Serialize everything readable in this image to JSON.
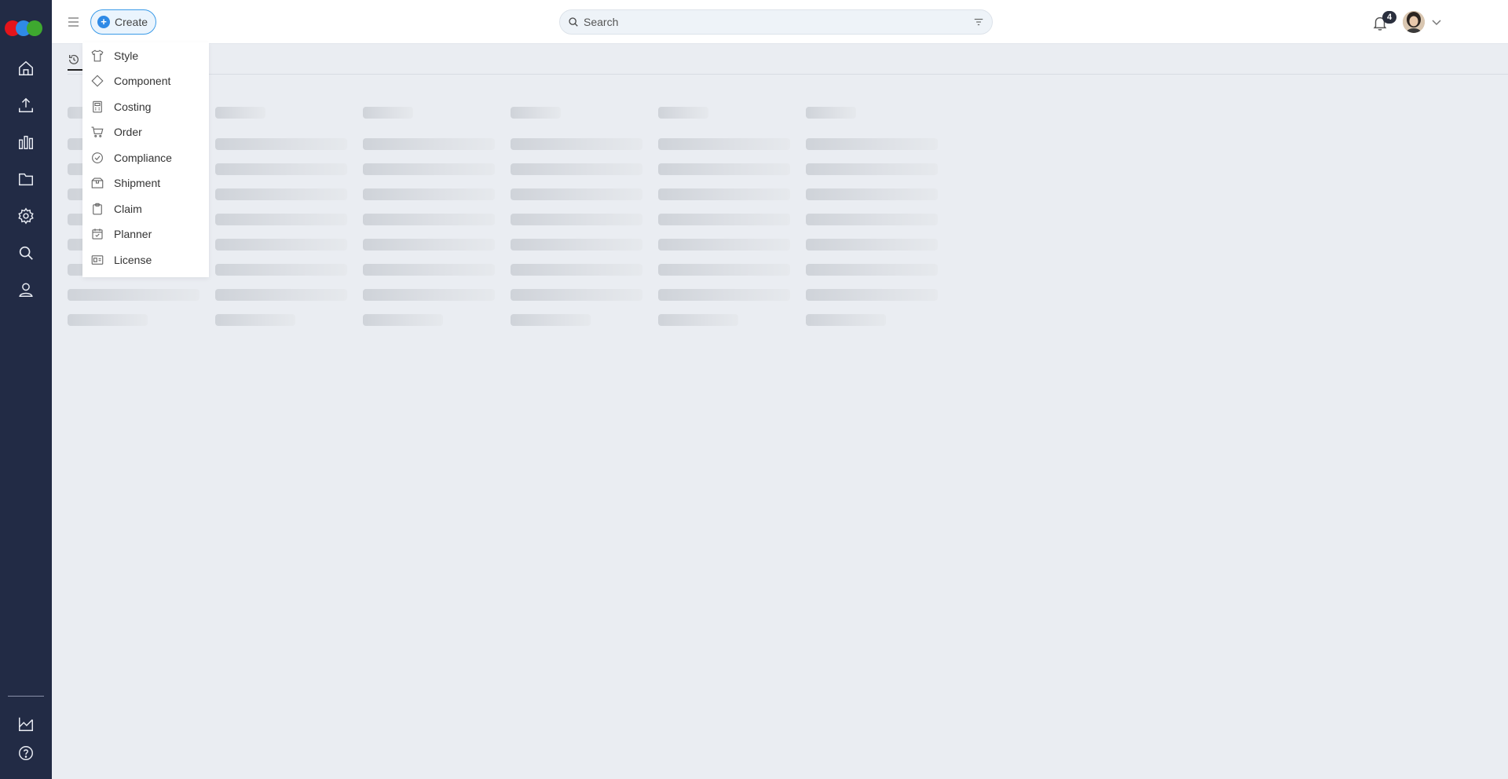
{
  "topbar": {
    "create_label": "Create",
    "search_placeholder": "Search",
    "notification_count": "4"
  },
  "create_menu": {
    "items": [
      {
        "label": "Style",
        "icon": "shirt-icon"
      },
      {
        "label": "Component",
        "icon": "diamond-icon"
      },
      {
        "label": "Costing",
        "icon": "calculator-icon"
      },
      {
        "label": "Order",
        "icon": "cart-icon"
      },
      {
        "label": "Compliance",
        "icon": "check-circle-icon"
      },
      {
        "label": "Shipment",
        "icon": "box-icon"
      },
      {
        "label": "Claim",
        "icon": "clipboard-icon"
      },
      {
        "label": "Planner",
        "icon": "calendar-check-icon"
      },
      {
        "label": "License",
        "icon": "id-card-icon"
      }
    ]
  },
  "sidebar": {
    "items": [
      "home-icon",
      "upload-icon",
      "bar-chart-icon",
      "folder-icon",
      "gear-icon",
      "search-icon",
      "user-icon"
    ],
    "bottom_items": [
      "analytics-icon",
      "help-icon"
    ]
  },
  "colors": {
    "sidebar_bg": "#222b45",
    "accent": "#2f8ae6",
    "logo_red": "#e4141b",
    "logo_blue": "#2f8ae6",
    "logo_green": "#3ea82f"
  }
}
